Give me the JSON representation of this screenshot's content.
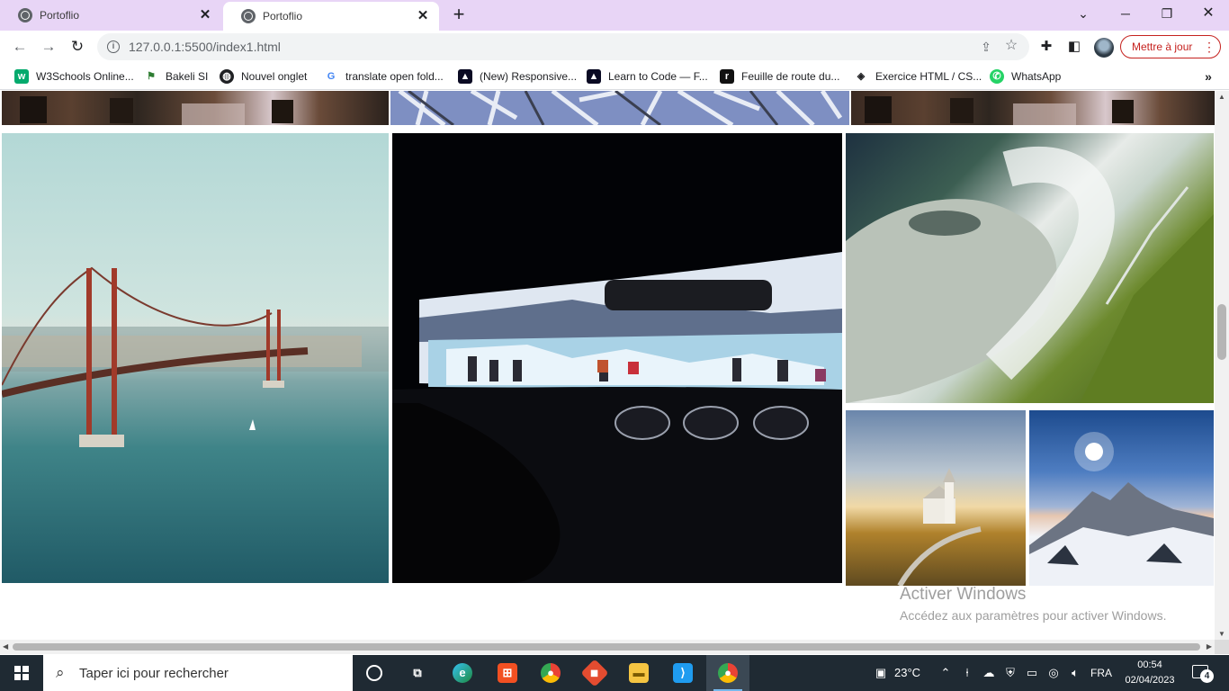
{
  "browser": {
    "tabs": [
      {
        "title": "Portoflio",
        "active": false
      },
      {
        "title": "Portoflio",
        "active": true
      }
    ],
    "new_tab_icon": "plus-icon",
    "address": "127.0.0.1:5500/index1.html",
    "update_label": "Mettre à jour",
    "bookmarks": [
      {
        "label": "W3Schools Online...",
        "icon": "w3schools-icon"
      },
      {
        "label": "Bakeli SI",
        "icon": "bakeli-icon"
      },
      {
        "label": "Nouvel onglet",
        "icon": "globe-icon"
      },
      {
        "label": "translate open fold...",
        "icon": "google-icon"
      },
      {
        "label": "(New) Responsive...",
        "icon": "freecodecamp-icon"
      },
      {
        "label": "Learn to Code — F...",
        "icon": "freecodecamp-icon"
      },
      {
        "label": "Feuille de route du...",
        "icon": "roadmap-icon"
      },
      {
        "label": "Exercice HTML / CS...",
        "icon": "diamond-icon"
      },
      {
        "label": "WhatsApp",
        "icon": "whatsapp-icon"
      }
    ]
  },
  "page": {
    "photos": [
      {
        "name": "top-left-photo",
        "subject": "street"
      },
      {
        "name": "top-mid-photo",
        "subject": "tree branches"
      },
      {
        "name": "top-right-photo",
        "subject": "street"
      },
      {
        "name": "bridge-photo",
        "subject": "suspension bridge"
      },
      {
        "name": "car-photo",
        "subject": "glacier through windshield"
      },
      {
        "name": "waterfall-photo",
        "subject": "waterfall"
      },
      {
        "name": "church-photo",
        "subject": "church"
      },
      {
        "name": "mountain-photo",
        "subject": "snowy mountain"
      }
    ]
  },
  "watermark": {
    "title": "Activer Windows",
    "subtitle": "Accédez aux paramètres pour activer Windows."
  },
  "taskbar": {
    "search_placeholder": "Taper ici pour rechercher",
    "apps": [
      "task-view",
      "widgets",
      "edge",
      "store",
      "chrome",
      "git",
      "explorer",
      "vscode",
      "chrome-active"
    ],
    "weather": "23°C",
    "language": "FRA",
    "time": "00:54",
    "date": "02/04/2023",
    "notifications": "4"
  },
  "colors": {
    "tabstrip": "#e8d5f6",
    "update_accent": "#c5221f",
    "taskbar": "#1f2a33"
  }
}
